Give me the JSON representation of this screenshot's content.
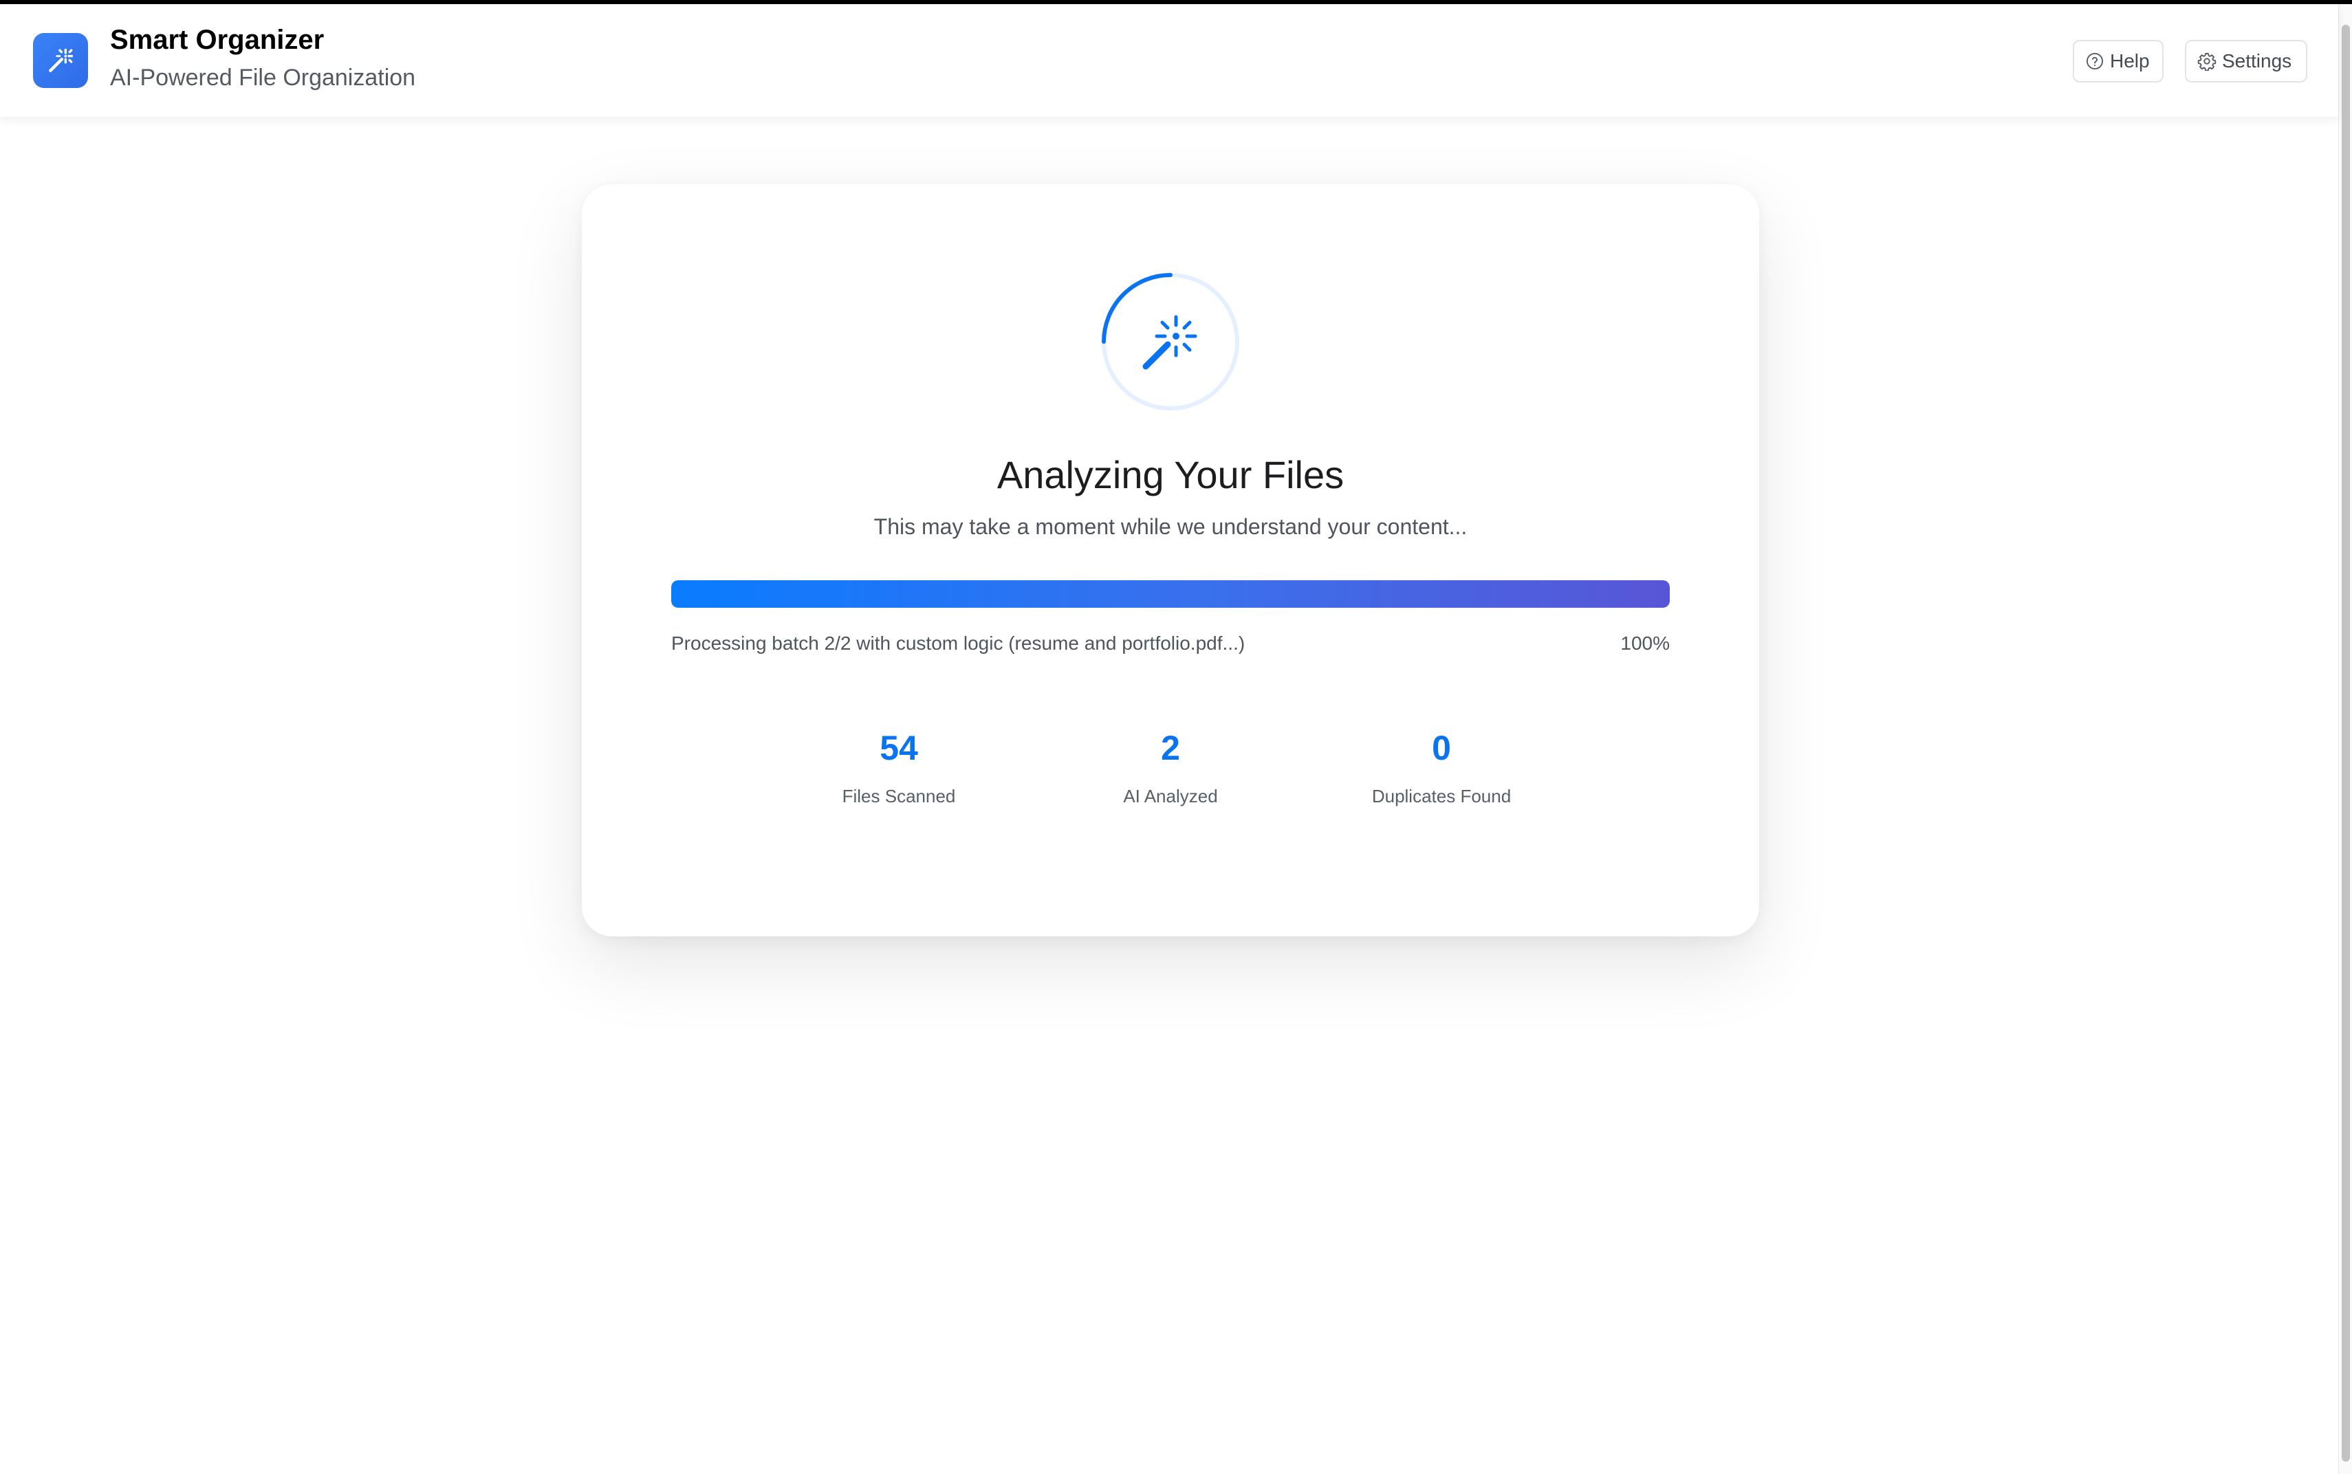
{
  "header": {
    "app_icon": "magic-wand-icon",
    "title": "Smart Organizer",
    "subtitle": "AI-Powered File Organization",
    "help_label": "Help",
    "help_icon": "help-circle-icon",
    "settings_label": "Settings",
    "settings_icon": "gear-icon"
  },
  "analysis": {
    "spinner_icon": "magic-wand-icon",
    "title": "Analyzing Your Files",
    "subtitle": "This may take a moment while we understand your content...",
    "progress_text": "Processing batch 2/2 with custom logic (resume and portfolio.pdf...)",
    "progress_percent_label": "100%",
    "progress_fraction": 1.0
  },
  "stats": [
    {
      "value": "54",
      "label": "Files Scanned"
    },
    {
      "value": "2",
      "label": "AI Analyzed"
    },
    {
      "value": "0",
      "label": "Duplicates Found"
    }
  ],
  "colors": {
    "accent": "#0a74f0",
    "progress_start": "#0a7cff",
    "progress_end": "#5856d6",
    "app_icon_bg": "#3a82f6"
  }
}
